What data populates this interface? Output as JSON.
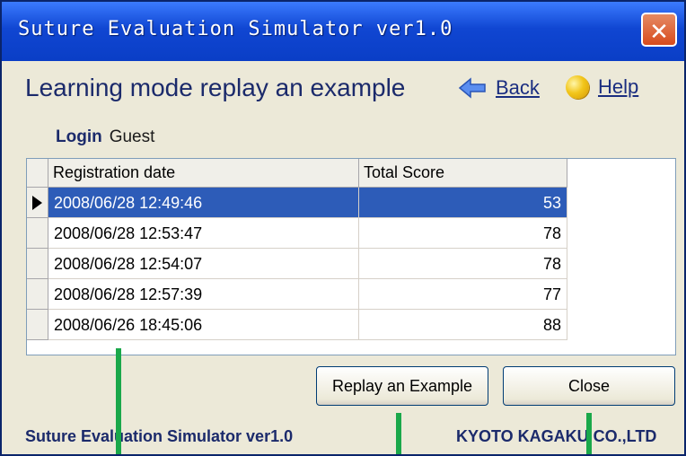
{
  "window": {
    "title": "Suture Evaluation Simulator ver1.0",
    "close_glyph": "✕"
  },
  "page": {
    "heading": "Learning mode replay an example",
    "back_label": "Back",
    "help_label": "Help",
    "back_icon": "back-arrow-icon",
    "help_icon": "help-circle-icon"
  },
  "login": {
    "label": "Login",
    "value": "Guest"
  },
  "table": {
    "columns": [
      "Registration date",
      "Total Score"
    ],
    "rows": [
      {
        "date": "2008/06/28 12:49:46",
        "score": "53",
        "selected": true
      },
      {
        "date": "2008/06/28 12:53:47",
        "score": "78"
      },
      {
        "date": "2008/06/28 12:54:07",
        "score": "78"
      },
      {
        "date": "2008/06/28 12:57:39",
        "score": "77"
      },
      {
        "date": "2008/06/26 18:45:06",
        "score": "88"
      }
    ]
  },
  "buttons": {
    "replay": "Replay an Example",
    "close": "Close"
  },
  "footer": {
    "left": "Suture Evaluation Simulator ver1.0",
    "right": "KYOTO KAGAKU CO.,LTD"
  },
  "colors": {
    "titlebar": "#1046d2",
    "selection": "#2d5cb8",
    "marker": "#1aa84a",
    "dialog_bg": "#ece9d8"
  }
}
